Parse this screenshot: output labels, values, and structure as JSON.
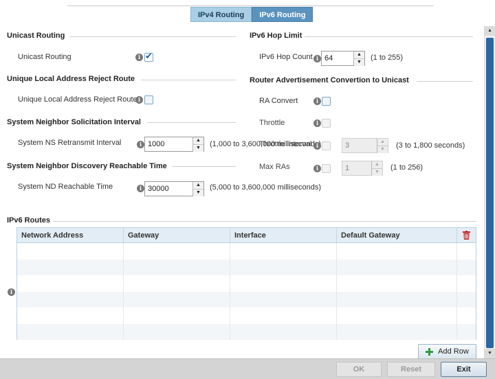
{
  "tabs": [
    {
      "label": "IPv4 Routing",
      "active": false
    },
    {
      "label": "IPv6 Routing",
      "active": true
    }
  ],
  "unicast": {
    "section": "Unicast Routing",
    "label": "Unicast Routing",
    "checked": true
  },
  "ula": {
    "section": "Unique Local Address Reject Route",
    "label": "Unique Local Address Reject Route",
    "checked": false
  },
  "nsi": {
    "section": "System Neighbor Solicitation Interval",
    "label": "System NS Retransmit Interval",
    "value": "1000",
    "hint": "(1,000 to 3,600,000 milliseconds)"
  },
  "ndrt": {
    "section": "System Neighbor Discovery Reachable Time",
    "label": "System ND Reachable Time",
    "value": "30000",
    "hint": "(5,000 to 3,600,000 milliseconds)"
  },
  "hop": {
    "section": "IPv6 Hop Limit",
    "label": "IPv6 Hop Count",
    "value": "64",
    "hint": "(1 to 255)"
  },
  "ra": {
    "section": "Router Advertisement Convertion to Unicast",
    "convert_label": "RA Convert",
    "throttle_label": "Throttle",
    "interval_label": "Throttle Interval",
    "interval_value": "3",
    "interval_hint": "(3 to 1,800 seconds)",
    "maxras_label": "Max RAs",
    "maxras_value": "1",
    "maxras_hint": "(1 to 256)"
  },
  "routes": {
    "section": "IPv6 Routes",
    "columns": [
      "Network Address",
      "Gateway",
      "Interface",
      "Default Gateway"
    ],
    "rows": 6,
    "add_label": "Add Row"
  },
  "footer": {
    "ok": "OK",
    "reset": "Reset",
    "exit": "Exit"
  },
  "colors": {
    "tab_active": "#5a93bf",
    "tab_inactive": "#a9cfe6",
    "checkbox": "#1e5f9b",
    "scroll_thumb": "#2c66a5",
    "delete_icon": "#c62828",
    "add_icon": "#2e9b3a"
  }
}
